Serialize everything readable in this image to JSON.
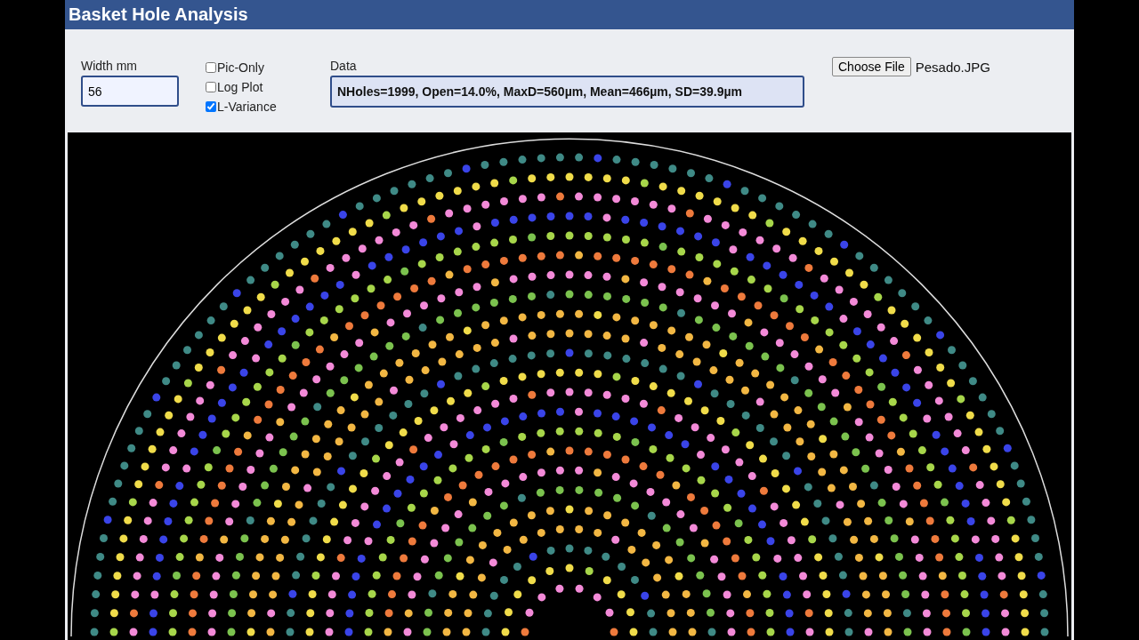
{
  "header": {
    "title": "Basket Hole Analysis"
  },
  "controls": {
    "width_field": {
      "label": "Width mm",
      "value": "56"
    },
    "options": [
      {
        "label": "Pic-Only",
        "checked": false
      },
      {
        "label": "Log Plot",
        "checked": false
      },
      {
        "label": "L-Variance",
        "checked": true
      }
    ],
    "data_field": {
      "label": "Data",
      "value": "NHoles=1999, Open=14.0%, MaxD=560µm, Mean=466µm, SD=39.9µm"
    },
    "file": {
      "button": "Choose File",
      "filename": "Pesado.JPG"
    }
  }
}
